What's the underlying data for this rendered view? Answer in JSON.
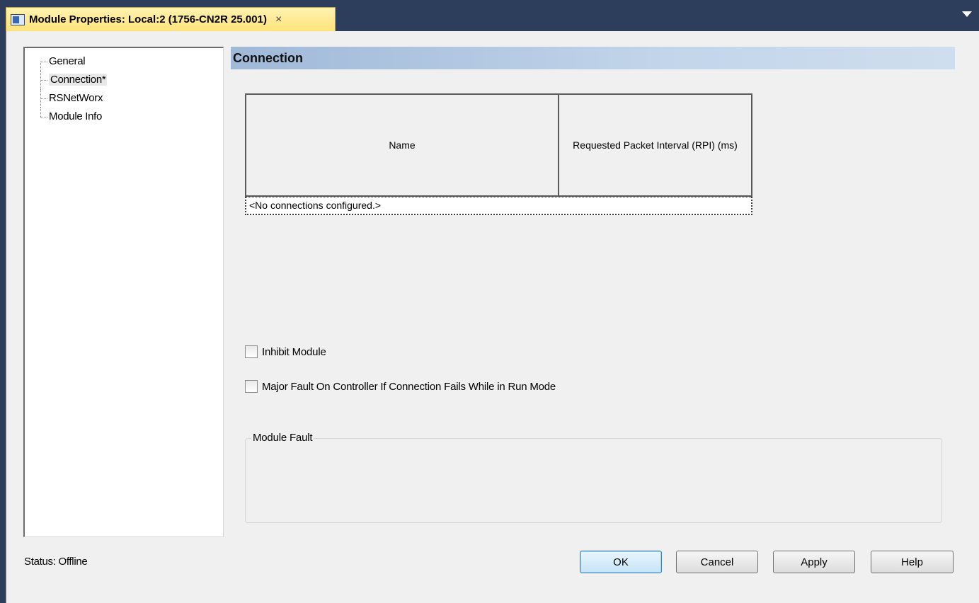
{
  "tab": {
    "title": "Module Properties: Local:2 (1756-CN2R 25.001)",
    "close_glyph": "×",
    "icon": "module-icon"
  },
  "tree": {
    "items": [
      {
        "label": "General"
      },
      {
        "label": "Connection*",
        "selected": true
      },
      {
        "label": "RSNetWorx"
      },
      {
        "label": "Module Info"
      }
    ]
  },
  "section": {
    "title": "Connection"
  },
  "grid": {
    "columns": [
      "Name",
      "Requested Packet Interval (RPI) (ms)"
    ],
    "empty_text": "<No connections configured.>"
  },
  "options": {
    "inhibit_module": {
      "label": "Inhibit Module",
      "checked": false
    },
    "major_fault": {
      "label": "Major Fault On Controller If Connection Fails While in Run Mode",
      "checked": false
    }
  },
  "module_fault": {
    "label": "Module Fault"
  },
  "status": {
    "text": "Status:  Offline"
  },
  "buttons": {
    "ok": "OK",
    "cancel": "Cancel",
    "apply": "Apply",
    "help": "Help"
  },
  "colors": {
    "tab_background": "#ffe27a",
    "window_background": "#2c3e5c",
    "dialog_background": "#f0f0f0",
    "section_header": "#c2d5ea"
  }
}
